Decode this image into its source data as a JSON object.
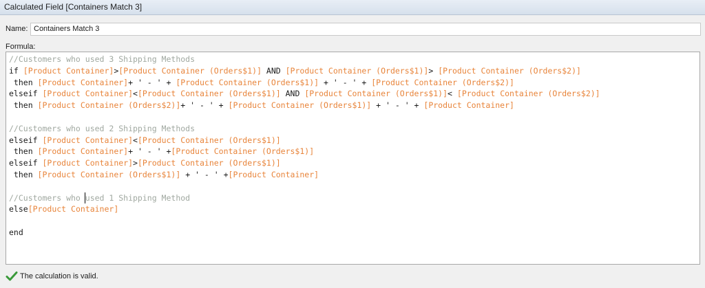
{
  "window": {
    "title": "Calculated Field [Containers Match 3]"
  },
  "name": {
    "label": "Name:",
    "value": "Containers Match 3"
  },
  "formula": {
    "label": "Formula:",
    "lines": [
      [
        {
          "t": "//Customers who used 3 Shipping Methods",
          "c": "cmt"
        }
      ],
      [
        {
          "t": "if ",
          "c": "kw"
        },
        {
          "t": "[Product Container]",
          "c": "fld"
        },
        {
          "t": ">",
          "c": "kw"
        },
        {
          "t": "[Product Container (Orders$1)]",
          "c": "fld"
        },
        {
          "t": " AND ",
          "c": "kw"
        },
        {
          "t": "[Product Container (Orders$1)]",
          "c": "fld"
        },
        {
          "t": "> ",
          "c": "kw"
        },
        {
          "t": "[Product Container (Orders$2)]",
          "c": "fld"
        }
      ],
      [
        {
          "t": " then ",
          "c": "kw"
        },
        {
          "t": "[Product Container]",
          "c": "fld"
        },
        {
          "t": "+ ' - ' + ",
          "c": "str"
        },
        {
          "t": "[Product Container (Orders$1)]",
          "c": "fld"
        },
        {
          "t": " + ' - ' + ",
          "c": "str"
        },
        {
          "t": "[Product Container (Orders$2)]",
          "c": "fld"
        }
      ],
      [
        {
          "t": "elseif ",
          "c": "kw"
        },
        {
          "t": "[Product Container]",
          "c": "fld"
        },
        {
          "t": "<",
          "c": "kw"
        },
        {
          "t": "[Product Container (Orders$1)]",
          "c": "fld"
        },
        {
          "t": " AND ",
          "c": "kw"
        },
        {
          "t": "[Product Container (Orders$1)]",
          "c": "fld"
        },
        {
          "t": "< ",
          "c": "kw"
        },
        {
          "t": "[Product Container (Orders$2)]",
          "c": "fld"
        }
      ],
      [
        {
          "t": " then ",
          "c": "kw"
        },
        {
          "t": "[Product Container (Orders$2)]",
          "c": "fld"
        },
        {
          "t": "+ ' - ' + ",
          "c": "str"
        },
        {
          "t": "[Product Container (Orders$1)]",
          "c": "fld"
        },
        {
          "t": " + ' - ' + ",
          "c": "str"
        },
        {
          "t": "[Product Container]",
          "c": "fld"
        }
      ],
      [],
      [
        {
          "t": "//Customers who used 2 Shipping Methods",
          "c": "cmt"
        }
      ],
      [
        {
          "t": "elseif ",
          "c": "kw"
        },
        {
          "t": "[Product Container]",
          "c": "fld"
        },
        {
          "t": "<",
          "c": "kw"
        },
        {
          "t": "[Product Container (Orders$1)]",
          "c": "fld"
        }
      ],
      [
        {
          "t": " then ",
          "c": "kw"
        },
        {
          "t": "[Product Container]",
          "c": "fld"
        },
        {
          "t": "+ ' - ' +",
          "c": "str"
        },
        {
          "t": "[Product Container (Orders$1)]",
          "c": "fld"
        }
      ],
      [
        {
          "t": "elseif ",
          "c": "kw"
        },
        {
          "t": "[Product Container]",
          "c": "fld"
        },
        {
          "t": ">",
          "c": "kw"
        },
        {
          "t": "[Product Container (Orders$1)]",
          "c": "fld"
        }
      ],
      [
        {
          "t": " then ",
          "c": "kw"
        },
        {
          "t": "[Product Container (Orders$1)]",
          "c": "fld"
        },
        {
          "t": " + ' - ' +",
          "c": "str"
        },
        {
          "t": "[Product Container]",
          "c": "fld"
        }
      ],
      [],
      [
        {
          "t": "//Customers who used 1 Shipping Method",
          "c": "cmt"
        }
      ],
      [
        {
          "t": "else",
          "c": "kw"
        },
        {
          "t": "[Product Container]",
          "c": "fld"
        }
      ],
      [],
      [
        {
          "t": "end",
          "c": "kw"
        }
      ]
    ]
  },
  "status": {
    "icon": "checkmark-icon",
    "text": "The calculation is valid.",
    "icon_color": "#3a9a3a"
  },
  "colors": {
    "field": "#e8843a",
    "comment": "#a0a8a0",
    "text": "#1a1a1a"
  }
}
